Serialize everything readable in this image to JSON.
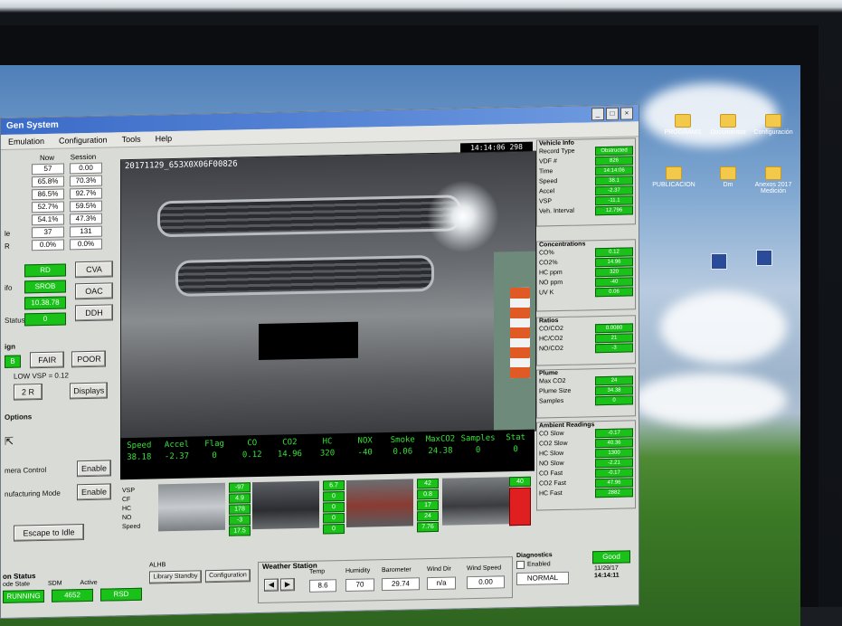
{
  "window": {
    "title": "Gen System",
    "menu": [
      "Emulation",
      "Configuration",
      "Tools",
      "Help"
    ],
    "clock": "14:14:06 298"
  },
  "left_panel": {
    "columns": [
      "Now",
      "Session"
    ],
    "rows": [
      {
        "label": "",
        "now": "57",
        "session": "0.00"
      },
      {
        "label": "",
        "now": "65.8%",
        "session": "70.3%"
      },
      {
        "label": "",
        "now": "86.5%",
        "session": "92.7%"
      },
      {
        "label": "",
        "now": "52.7%",
        "session": "59.5%"
      },
      {
        "label": "",
        "now": "54.1%",
        "session": "47.3%"
      },
      {
        "label": "le",
        "now": "37",
        "session": "131"
      },
      {
        "label": "R",
        "now": "0.0%",
        "session": "0.0%"
      }
    ],
    "status_labels": [
      "RD",
      "SROB",
      "10.38.78",
      "0"
    ],
    "status_row_labels": [
      "",
      "ifo",
      "",
      "Status"
    ],
    "buttons_right": [
      "CVA",
      "OAC",
      "DDH"
    ],
    "sign_header": "ign",
    "sign_buttons": [
      "B",
      "FAIR",
      "POOR"
    ],
    "sign_line": "LOW VSP = 0.12",
    "sign_value": "2 R",
    "sign_button": "Displays",
    "options_header": "Options",
    "ctrl_rows": [
      {
        "label": "mera Control",
        "button": "Enable"
      },
      {
        "label": "nufacturing Mode",
        "button": "Enable"
      }
    ],
    "escape_button": "Escape to Idle"
  },
  "camera": {
    "timestamp": "20171129_653X0X06F00826",
    "readouts": [
      {
        "label": "Speed",
        "value": "38.18"
      },
      {
        "label": "Accel",
        "value": "-2.37"
      },
      {
        "label": "Flag",
        "value": "0"
      },
      {
        "label": "CO",
        "value": "0.12"
      },
      {
        "label": "CO2",
        "value": "14.96"
      },
      {
        "label": "HC",
        "value": "320"
      },
      {
        "label": "NOX",
        "value": "-40"
      },
      {
        "label": "Smoke",
        "value": "0.06"
      },
      {
        "label": "MaxCO2",
        "value": "24.38"
      },
      {
        "label": "Samples",
        "value": "0"
      },
      {
        "label": "Stat",
        "value": "0"
      }
    ]
  },
  "thumbnails": {
    "labels": [
      "VSP",
      "CF",
      "HC",
      "NO",
      "Speed"
    ],
    "cols": [
      [
        "-97",
        "4.9",
        "178",
        "-3",
        "17.5"
      ],
      [
        "6.7",
        "0",
        "0",
        "0",
        "0"
      ],
      [
        "42",
        "0.8",
        "17",
        "24",
        "7.76"
      ],
      [
        "40",
        "",
        "",
        "",
        ""
      ]
    ]
  },
  "right_panel": {
    "vehicle_info": {
      "title": "Vehicle Info",
      "rows": [
        {
          "label": "Record Type",
          "value": "Obstructed"
        },
        {
          "label": "VDF #",
          "value": "826"
        },
        {
          "label": "Time",
          "value": "14:14:06"
        },
        {
          "label": "Speed",
          "value": "38.1"
        },
        {
          "label": "Accel",
          "value": "-2.37"
        },
        {
          "label": "VSP",
          "value": "-11.1"
        },
        {
          "label": "Veh. Interval",
          "value": "12.796"
        }
      ]
    },
    "concentrations": {
      "title": "Concentrations",
      "rows": [
        {
          "label": "CO%",
          "value": "0.12"
        },
        {
          "label": "CO2%",
          "value": "14.96"
        },
        {
          "label": "HC ppm",
          "value": "320"
        },
        {
          "label": "NO ppm",
          "value": "-40"
        },
        {
          "label": "UV K",
          "value": "0.06"
        }
      ]
    },
    "ratios": {
      "title": "Ratios",
      "rows": [
        {
          "label": "CO/CO2",
          "value": "0.0080"
        },
        {
          "label": "HC/CO2",
          "value": "21"
        },
        {
          "label": "NO/CO2",
          "value": "-3"
        }
      ]
    },
    "plume": {
      "title": "Plume",
      "rows": [
        {
          "label": "Max CO2",
          "value": "24"
        },
        {
          "label": "Plume Size",
          "value": "34.38"
        },
        {
          "label": "Samples",
          "value": "0"
        }
      ]
    },
    "ambient": {
      "title": "Ambient Readings",
      "rows": [
        {
          "label": "CO Slow",
          "value": "-0.17"
        },
        {
          "label": "CO2 Slow",
          "value": "40.36"
        },
        {
          "label": "HC Slow",
          "value": "1300"
        },
        {
          "label": "NO Slow",
          "value": "-2.21"
        },
        {
          "label": "CO Fast",
          "value": "-0.17"
        },
        {
          "label": "CO2 Fast",
          "value": "47.96"
        },
        {
          "label": "HC Fast",
          "value": "2882"
        }
      ]
    }
  },
  "bottom": {
    "station_title": "on Status",
    "station_labels": [
      "ode State",
      "SDM",
      "Active"
    ],
    "station_values": [
      "RUNNING",
      "4652",
      "RSD"
    ],
    "alhb": "ALHB",
    "alhb_items": [
      "Library Standby",
      "Configuration"
    ],
    "weather_title": "Weather Station",
    "weather_labels": [
      "Temp",
      "Humidity",
      "Barometer",
      "Wind Dir",
      "Wind Speed"
    ],
    "weather_values": [
      "8.6",
      "70",
      "29.74",
      "n/a",
      "0.00"
    ],
    "diag_title": "Diagnostics",
    "diag_enabled": "Enabled",
    "diag_status": "NORMAL",
    "diag_badge": "Good",
    "date": "11/29/17",
    "time": "14:14:11"
  },
  "desktop": {
    "icons": [
      "PROGRAMS",
      "Documentos",
      "Configuración",
      "PUBLICACION",
      "Dm",
      "Anexos 2017 Medición"
    ]
  },
  "colors": {
    "status_green": "#19c119",
    "alert_red": "#e02020",
    "readout_green": "#38e038"
  }
}
